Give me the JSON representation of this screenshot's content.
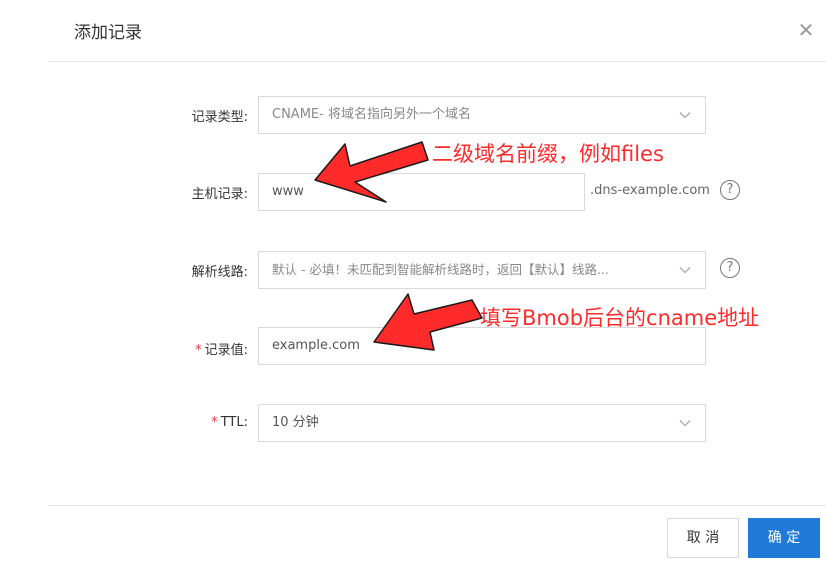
{
  "dialog": {
    "title": "添加记录",
    "close_icon": "✕"
  },
  "form": {
    "record_type": {
      "label": "记录类型:",
      "value": "CNAME- 将域名指向另外一个域名"
    },
    "host": {
      "label": "主机记录:",
      "value": "www",
      "suffix": ".dns-example.com"
    },
    "line": {
      "label": "解析线路:",
      "value": "默认 - 必填！未匹配到智能解析线路时，返回【默认】线路..."
    },
    "value": {
      "required_mark": "*",
      "label": "记录值:",
      "value": "example.com"
    },
    "ttl": {
      "required_mark": "*",
      "label": "TTL:",
      "value": "10 分钟"
    }
  },
  "help_icon": "?",
  "annotations": {
    "host_hint": "二级域名前缀，例如files",
    "value_hint": "填写Bmob后台的cname地址",
    "color": "#ff2a2a"
  },
  "footer": {
    "cancel_label": "取 消",
    "ok_label": "确 定"
  },
  "colors": {
    "primary": "#1f7ad8",
    "border": "#d9d9d9"
  }
}
